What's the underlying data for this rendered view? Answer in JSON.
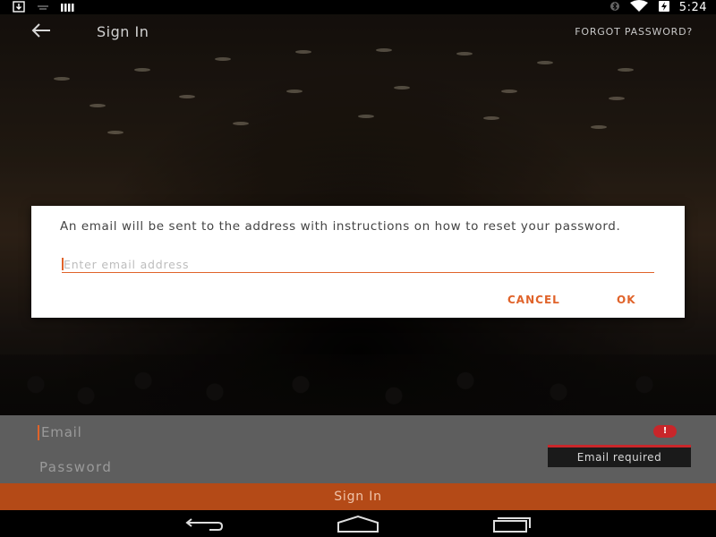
{
  "status_bar": {
    "time": "5:24",
    "left_icons": [
      "download-icon",
      "sim-icon",
      "signal-bars-icon"
    ],
    "right_icons": [
      "bluetooth-icon",
      "wifi-icon",
      "battery-charging-icon"
    ]
  },
  "app_bar": {
    "title": "Sign In",
    "back_icon": "back-arrow-icon",
    "forgot_password_label": "FORGOT PASSWORD?"
  },
  "dialog": {
    "message": "An email will be sent to the address with instructions on how to reset your password.",
    "email_placeholder": "Enter email address",
    "cancel_label": "CANCEL",
    "ok_label": "OK"
  },
  "form": {
    "email_label": "Email",
    "password_label": "Password",
    "error_icon": "error-icon",
    "error_message": "Email required",
    "sign_in_label": "Sign In"
  },
  "nav_bar": {
    "icons": [
      "back-icon",
      "home-icon",
      "recents-icon"
    ]
  },
  "colors": {
    "accent": "#e0632a",
    "sign_in_button": "#b44a17",
    "error": "#c8262a",
    "form_background": "#5e5e5e"
  }
}
